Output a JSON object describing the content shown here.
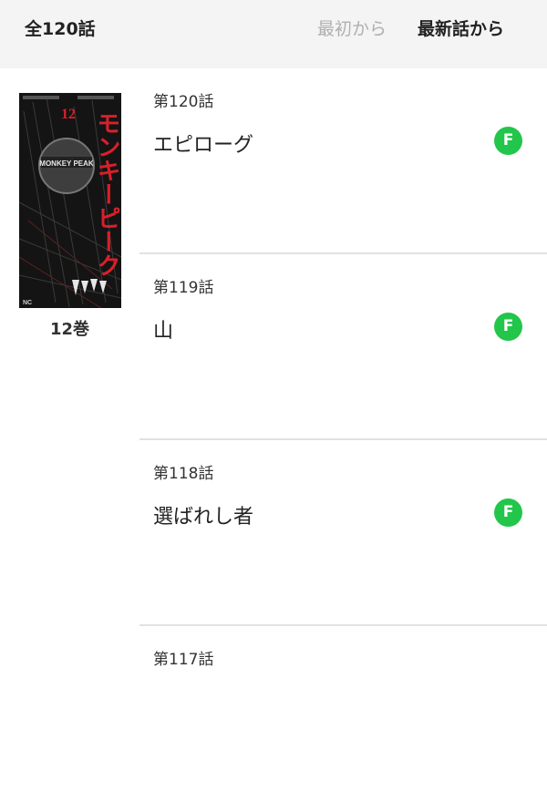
{
  "header": {
    "total_label": "全120話",
    "sort_oldest_label": "最初から",
    "sort_newest_label": "最新話から"
  },
  "volume": {
    "label": "12巻",
    "cover": {
      "title_vertical": "モンキーピーク",
      "number": "12",
      "center_label": "MONKEY PEAK",
      "brand": "NC",
      "accent_color": "#d8202a"
    }
  },
  "colors": {
    "free_badge": "#22c64a",
    "divider": "#e2e2e2",
    "header_bg": "#f4f4f4"
  },
  "episodes": [
    {
      "number": "第120話",
      "title": "エピローグ",
      "badge": "F"
    },
    {
      "number": "第119話",
      "title": "山",
      "badge": "F"
    },
    {
      "number": "第118話",
      "title": "選ばれし者",
      "badge": "F"
    },
    {
      "number": "第117話",
      "title": "",
      "badge": ""
    }
  ]
}
